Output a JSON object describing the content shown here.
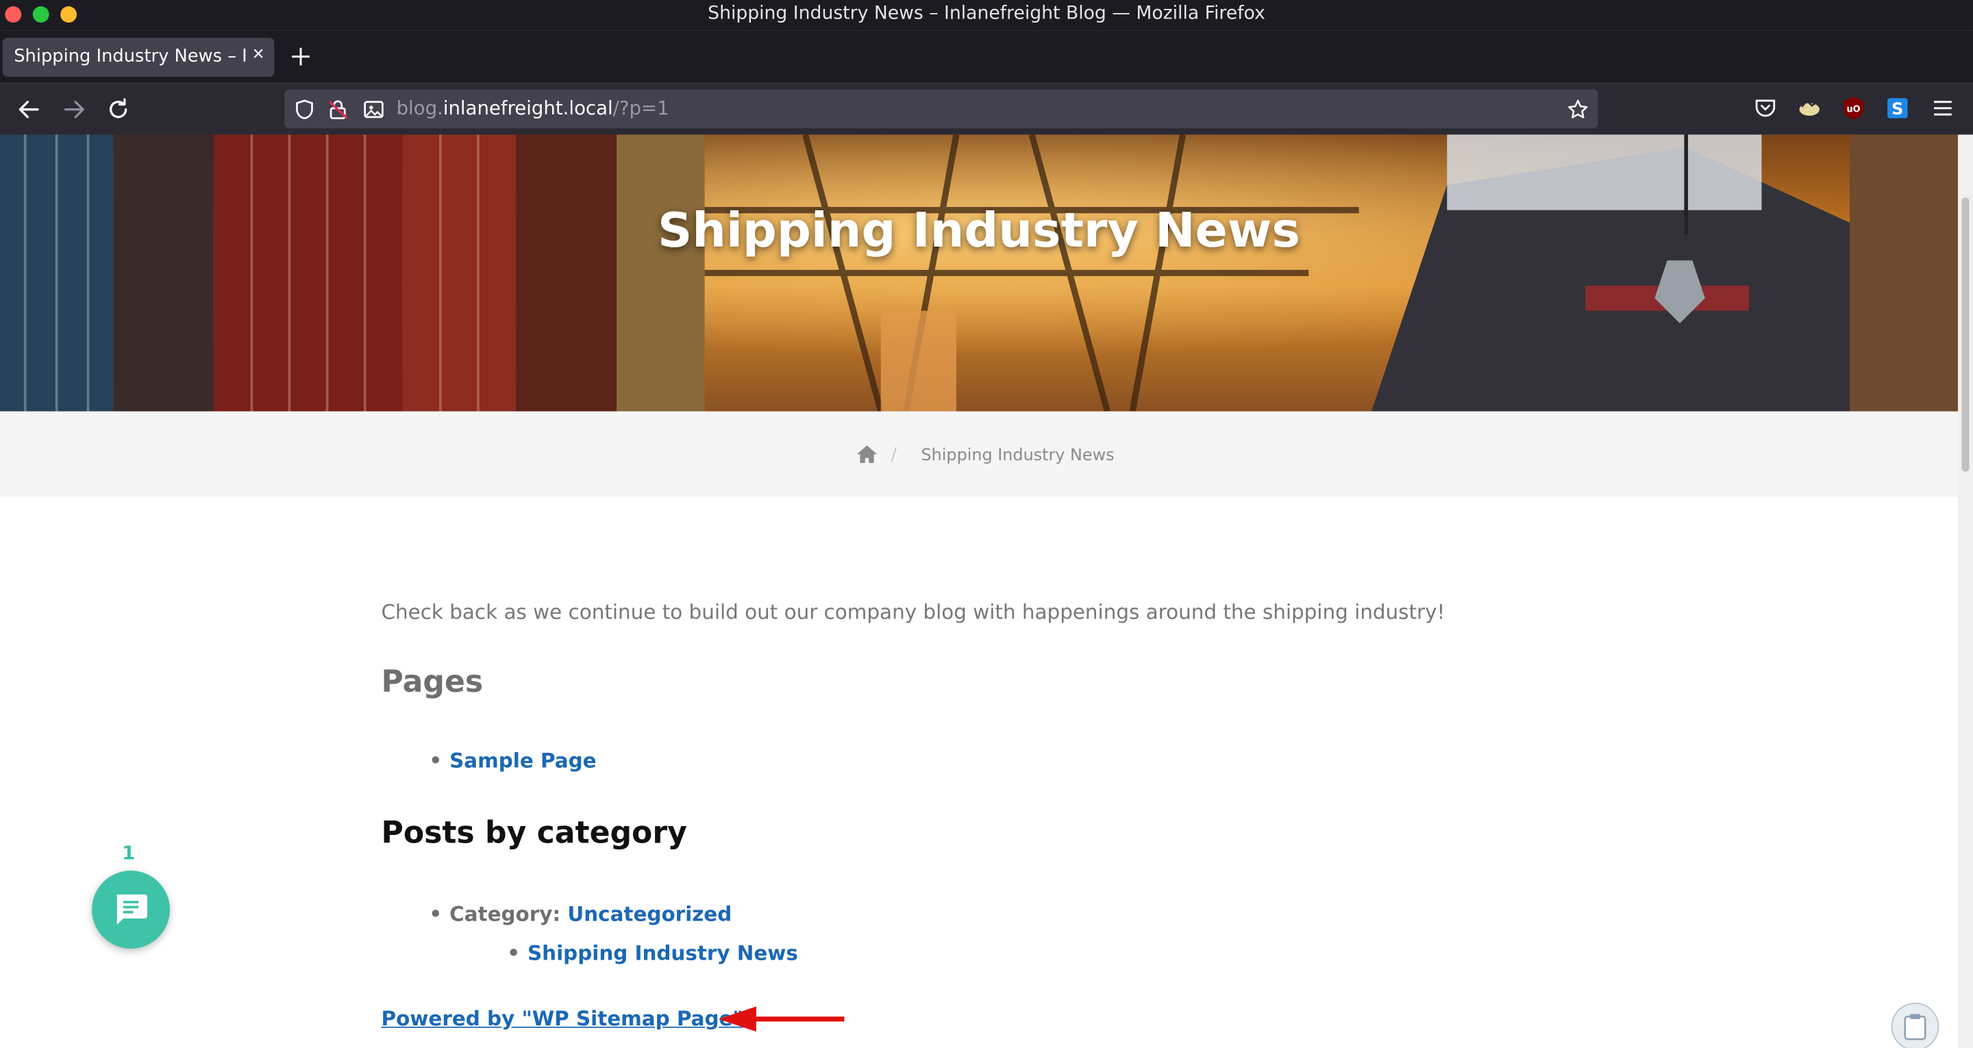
{
  "window": {
    "title": "Shipping Industry News – Inlanefreight Blog — Mozilla Firefox"
  },
  "tab": {
    "title": "Shipping Industry News – Inlanefreight Blog",
    "close": "×"
  },
  "urlbar": {
    "prefix": "blog.",
    "host": "inlanefreight.local",
    "path": "/?p=1"
  },
  "hero": {
    "title": "Shipping Industry News"
  },
  "breadcrumb": {
    "separator": "/",
    "current": "Shipping Industry News"
  },
  "content": {
    "intro": "Check back as we continue to build out our company blog with happenings around the shipping industry!",
    "pages_heading": "Pages",
    "pages": [
      {
        "label": "Sample Page"
      }
    ],
    "posts_heading": "Posts by category",
    "category_label": "Category:",
    "category_name": "Uncategorized",
    "posts": [
      {
        "label": "Shipping Industry News"
      }
    ],
    "bullet": "•",
    "powered_by": "Powered by \"WP Sitemap Page\""
  },
  "chat": {
    "badge": "1"
  },
  "colors": {
    "link": "#1b68b4",
    "chat": "#3fc3a8",
    "annotation_arrow": "#e01010"
  }
}
